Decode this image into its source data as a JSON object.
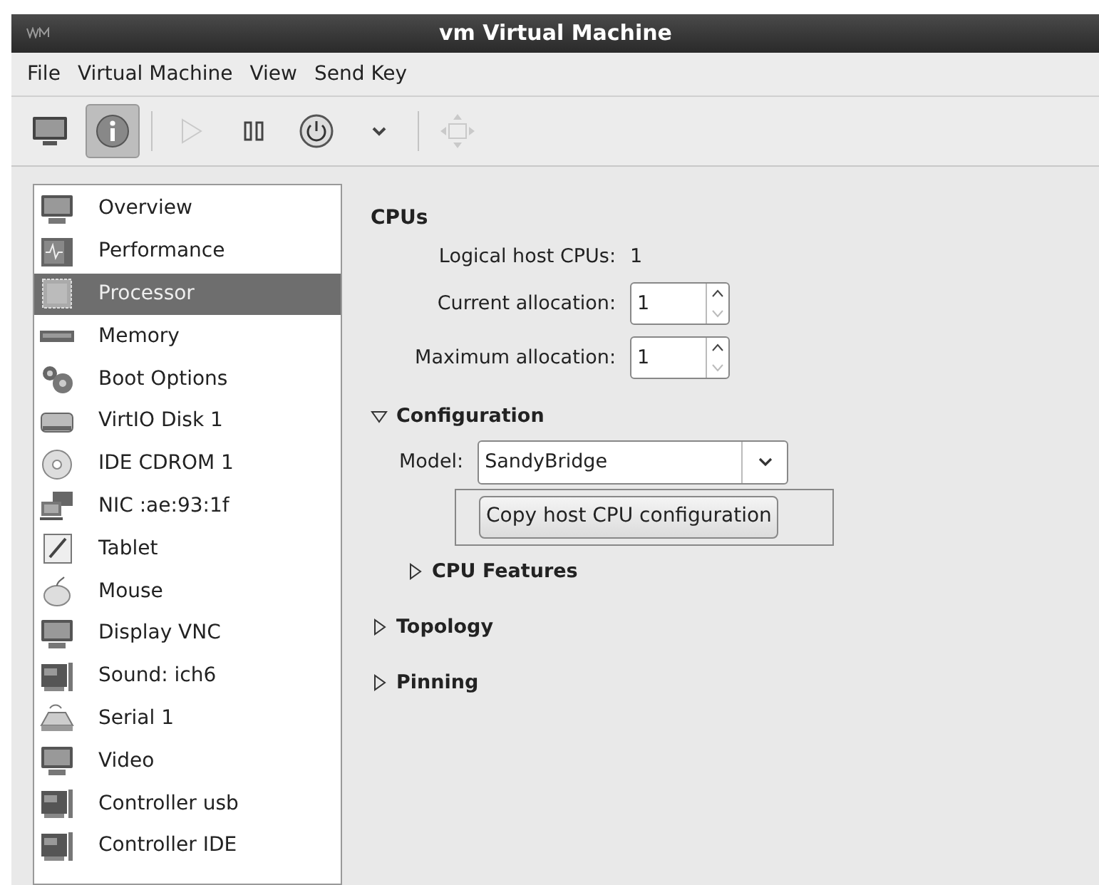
{
  "window": {
    "title": "vm Virtual Machine"
  },
  "menu": [
    "File",
    "Virtual Machine",
    "View",
    "Send Key"
  ],
  "toolbar": [
    {
      "kind": "console",
      "selected": false,
      "disabled": false
    },
    {
      "kind": "details",
      "selected": true,
      "disabled": false
    },
    {
      "kind": "separator"
    },
    {
      "kind": "run",
      "selected": false,
      "disabled": true
    },
    {
      "kind": "pause",
      "selected": false,
      "disabled": false
    },
    {
      "kind": "power",
      "selected": false,
      "disabled": false
    },
    {
      "kind": "dropdown",
      "selected": false,
      "disabled": false
    },
    {
      "kind": "separator"
    },
    {
      "kind": "fullscreen",
      "selected": false,
      "disabled": true
    }
  ],
  "sidebar": {
    "items": [
      {
        "label": "Overview",
        "kind": "monitor",
        "selected": false
      },
      {
        "label": "Performance",
        "kind": "chart",
        "selected": false
      },
      {
        "label": "Processor",
        "kind": "chip",
        "selected": true
      },
      {
        "label": "Memory",
        "kind": "ram",
        "selected": false
      },
      {
        "label": "Boot Options",
        "kind": "gears",
        "selected": false
      },
      {
        "label": "VirtIO Disk 1",
        "kind": "disk",
        "selected": false
      },
      {
        "label": "IDE CDROM 1",
        "kind": "cd",
        "selected": false
      },
      {
        "label": "NIC :ae:93:1f",
        "kind": "network",
        "selected": false
      },
      {
        "label": "Tablet",
        "kind": "tablet",
        "selected": false
      },
      {
        "label": "Mouse",
        "kind": "mouse",
        "selected": false
      },
      {
        "label": "Display VNC",
        "kind": "monitor",
        "selected": false
      },
      {
        "label": "Sound: ich6",
        "kind": "card",
        "selected": false
      },
      {
        "label": "Serial 1",
        "kind": "serial",
        "selected": false
      },
      {
        "label": "Video",
        "kind": "monitor",
        "selected": false
      },
      {
        "label": "Controller usb",
        "kind": "card",
        "selected": false
      },
      {
        "label": "Controller IDE",
        "kind": "card",
        "selected": false
      }
    ]
  },
  "cpus": {
    "heading": "CPUs",
    "logical_label": "Logical host CPUs:",
    "logical_value": "1",
    "current_label": "Current allocation:",
    "current_value": "1",
    "maximum_label": "Maximum allocation:",
    "maximum_value": "1"
  },
  "configuration": {
    "label": "Configuration",
    "expanded": true,
    "model_label": "Model:",
    "model_value": "SandyBridge",
    "copy_button": "Copy host CPU configuration",
    "features": {
      "label": "CPU Features",
      "expanded": false
    }
  },
  "sections": [
    {
      "label": "Topology",
      "expanded": false
    },
    {
      "label": "Pinning",
      "expanded": false
    }
  ]
}
